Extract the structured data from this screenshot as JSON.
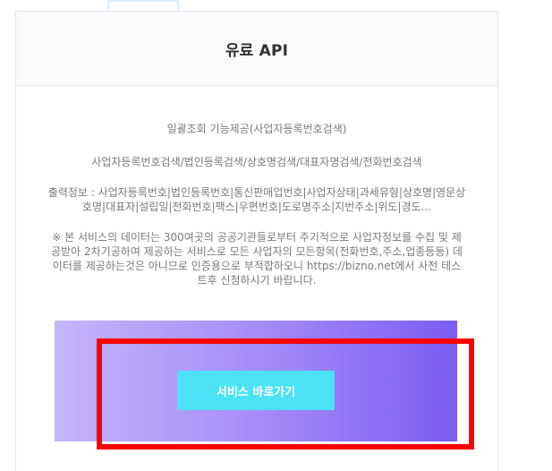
{
  "card": {
    "title": "유료 API",
    "feature_line": "일괄조회 기능제공(사업자등록번호검색)",
    "search_line": "사업자등록번호검색/법인등록검색/상호명검색/대표자명검색/전화번호검색",
    "output_lines": [
      "출력정보 : 사업자등록번호|법인등록번호|통신판매업번호|사업자상태|과세유형|상호명|영문상",
      "호명|대표자|설립일|전화번호|팩스|우편번호|도로명주소|지번주소|위도|경도..."
    ],
    "note_lines": [
      "※ 본 서비스의 데이터는 300여곳의 공공기관들로부터 주기적으로 사업자정보를 수집 및 제",
      "공받아 2차기공하여 제공하는 서비스로 모든 사업자의 모든항목(전화번호,주소,업종등등) 데",
      "이터를 제공하는것은 아니므로 인증용으로 부적합하오니 https://bizno.net에서 사전 테스",
      "트후 신청하시기 바랍니다."
    ]
  },
  "cta": {
    "button_label": "서비스 바로가기"
  },
  "colors": {
    "button": "#4ce2f5",
    "band_start": "#c5b5fb",
    "band_end": "#7b5cf3",
    "highlight": "#ff0000"
  }
}
